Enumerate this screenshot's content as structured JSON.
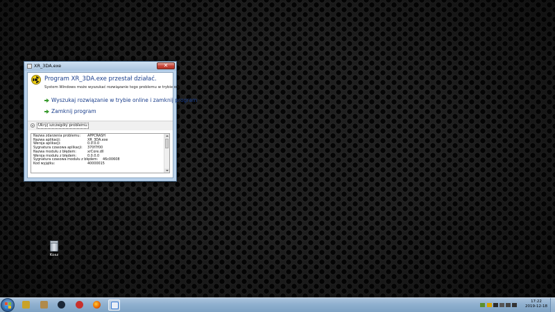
{
  "dialog": {
    "window_title": "XR_3DA.exe",
    "close_label": "✕",
    "heading": "Program XR_3DA.exe przestał działać.",
    "description": "System Windows może wyszukać rozwiązanie tego problemu w trybie online.",
    "commands": [
      {
        "label": "Wyszukaj rozwiązanie w trybie online i zamknij program"
      },
      {
        "label": "Zamknij program"
      }
    ],
    "details_toggle": "Ukryj szczegóły problemu",
    "details": [
      {
        "key": "Nazwa zdarzenia problemu:",
        "value": "APPCRASH"
      },
      {
        "key": "Nazwa aplikacji:",
        "value": "XR_3DA.exe"
      },
      {
        "key": "Wersja aplikacji:",
        "value": "0.0.0.0"
      },
      {
        "key": "Sygnatura czasowa aplikacji:",
        "value": "370f7f00"
      },
      {
        "key": "Nazwa modułu z błędem:",
        "value": "xrCore.dll"
      },
      {
        "key": "Wersja modułu z błędem:",
        "value": "0.0.0.0"
      },
      {
        "key": "Sygnatura czasowa modułu z błędem:",
        "value": "46c00608"
      },
      {
        "key": "Kod wyjątku:",
        "value": "40000015"
      }
    ]
  },
  "desktop": {
    "recycle_bin_label": "Kosz"
  },
  "taskbar": {
    "clock_time": "17:22",
    "clock_date": "2019-12-18",
    "apps": [
      {
        "name": "app-pinned-1-icon",
        "color": "#c9a227"
      },
      {
        "name": "app-pinned-2-icon",
        "color": "#b08a4a"
      },
      {
        "name": "steam-icon",
        "color": "#1b2838"
      },
      {
        "name": "app-pinned-4-icon",
        "color": "#c8302c"
      },
      {
        "name": "firefox-icon",
        "color": "#e66000"
      },
      {
        "name": "error-reporting-icon",
        "color": "#3a7bd5"
      }
    ]
  }
}
